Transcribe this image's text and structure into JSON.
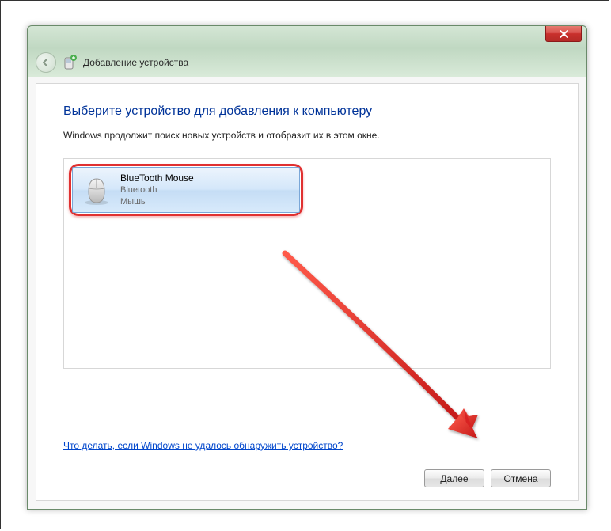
{
  "window": {
    "title": "Добавление устройства"
  },
  "main": {
    "heading": "Выберите устройство для добавления к компьютеру",
    "subtext": "Windows продолжит поиск новых устройств и отобразит их в этом окне."
  },
  "device": {
    "name": "BlueTooth Mouse",
    "type": "Bluetooth",
    "category": "Мышь"
  },
  "help_link": "Что делать, если Windows не удалось обнаружить устройство?",
  "buttons": {
    "next": "Далее",
    "cancel": "Отмена"
  },
  "colors": {
    "accent_heading": "#003399",
    "link": "#0046cc",
    "selection_border": "#7aa7d8",
    "annotation_red": "#e03030"
  }
}
